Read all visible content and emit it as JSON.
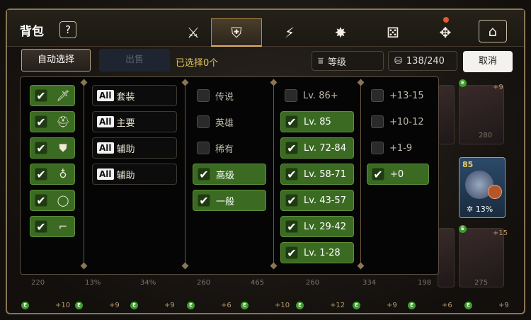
{
  "header": {
    "title": "背包",
    "help_label": "?",
    "tabs": [
      {
        "icon": "sword-shield-icon",
        "glyph": "⚔",
        "active": false
      },
      {
        "icon": "shield-crossed-icon",
        "glyph": "⛨",
        "active": true
      },
      {
        "icon": "lightning-icon",
        "glyph": "⚡",
        "active": false
      },
      {
        "icon": "spiky-emblem-icon",
        "glyph": "✸",
        "active": false
      },
      {
        "icon": "dice-icon",
        "glyph": "⚄",
        "active": false
      },
      {
        "icon": "puzzle-icon",
        "glyph": "✥",
        "active": false
      },
      {
        "icon": "storage-house-icon",
        "glyph": "⌂",
        "active": false
      }
    ]
  },
  "toolbar": {
    "auto_select": "自动选择",
    "sell": "出售",
    "selected_text": "已选择0个",
    "sort_label": "等级",
    "inventory_count": "138/240",
    "cancel": "取消"
  },
  "filters": {
    "slots": [
      {
        "icon": "weapon-icon",
        "glyph": "🗡",
        "checked": true
      },
      {
        "icon": "helmet-icon",
        "glyph": "⛑",
        "checked": true
      },
      {
        "icon": "armor-icon",
        "glyph": "⛊",
        "checked": true
      },
      {
        "icon": "necklace-icon",
        "glyph": "♁",
        "checked": true
      },
      {
        "icon": "ring-icon",
        "glyph": "◯",
        "checked": true
      },
      {
        "icon": "boots-icon",
        "glyph": "⌐",
        "checked": true
      }
    ],
    "sets": [
      {
        "tag": "All",
        "label": "套装"
      },
      {
        "tag": "All",
        "label": "主要"
      },
      {
        "tag": "All",
        "label": "辅助"
      },
      {
        "tag": "All",
        "label": "辅助"
      }
    ],
    "rarity": [
      {
        "label": "传说",
        "checked": false
      },
      {
        "label": "英雄",
        "checked": false
      },
      {
        "label": "稀有",
        "checked": false
      },
      {
        "label": "高级",
        "checked": true
      },
      {
        "label": "一般",
        "checked": true
      }
    ],
    "levels": [
      {
        "label": "Lv. 86+",
        "checked": false
      },
      {
        "label": "Lv. 85",
        "checked": true
      },
      {
        "label": "Lv. 72-84",
        "checked": true
      },
      {
        "label": "Lv. 58-71",
        "checked": true
      },
      {
        "label": "Lv. 43-57",
        "checked": true
      },
      {
        "label": "Lv. 29-42",
        "checked": true
      },
      {
        "label": "Lv. 1-28",
        "checked": true
      }
    ],
    "enhance": [
      {
        "label": "+13-15",
        "checked": false
      },
      {
        "label": "+10-12",
        "checked": false
      },
      {
        "label": "+1-9",
        "checked": false
      },
      {
        "label": "+0",
        "checked": true
      }
    ]
  },
  "background": {
    "right_card": {
      "level": "85",
      "percent": "13%"
    },
    "right_stats": [
      "280"
    ],
    "bottom_stats": [
      "220",
      "13%",
      "34%",
      "260",
      "465",
      "260",
      "334",
      "198",
      "275"
    ],
    "bottom_plus": [
      "+10",
      "+9",
      "+9",
      "+6",
      "+10",
      "+12",
      "+9",
      "+6",
      "+9"
    ],
    "right_plus": [
      "+9",
      "+15"
    ],
    "e_badge": "E"
  },
  "colors": {
    "checked_green": "#3b6b22",
    "accent_gold": "#e0b060",
    "selected_text": "#e2c75e"
  }
}
